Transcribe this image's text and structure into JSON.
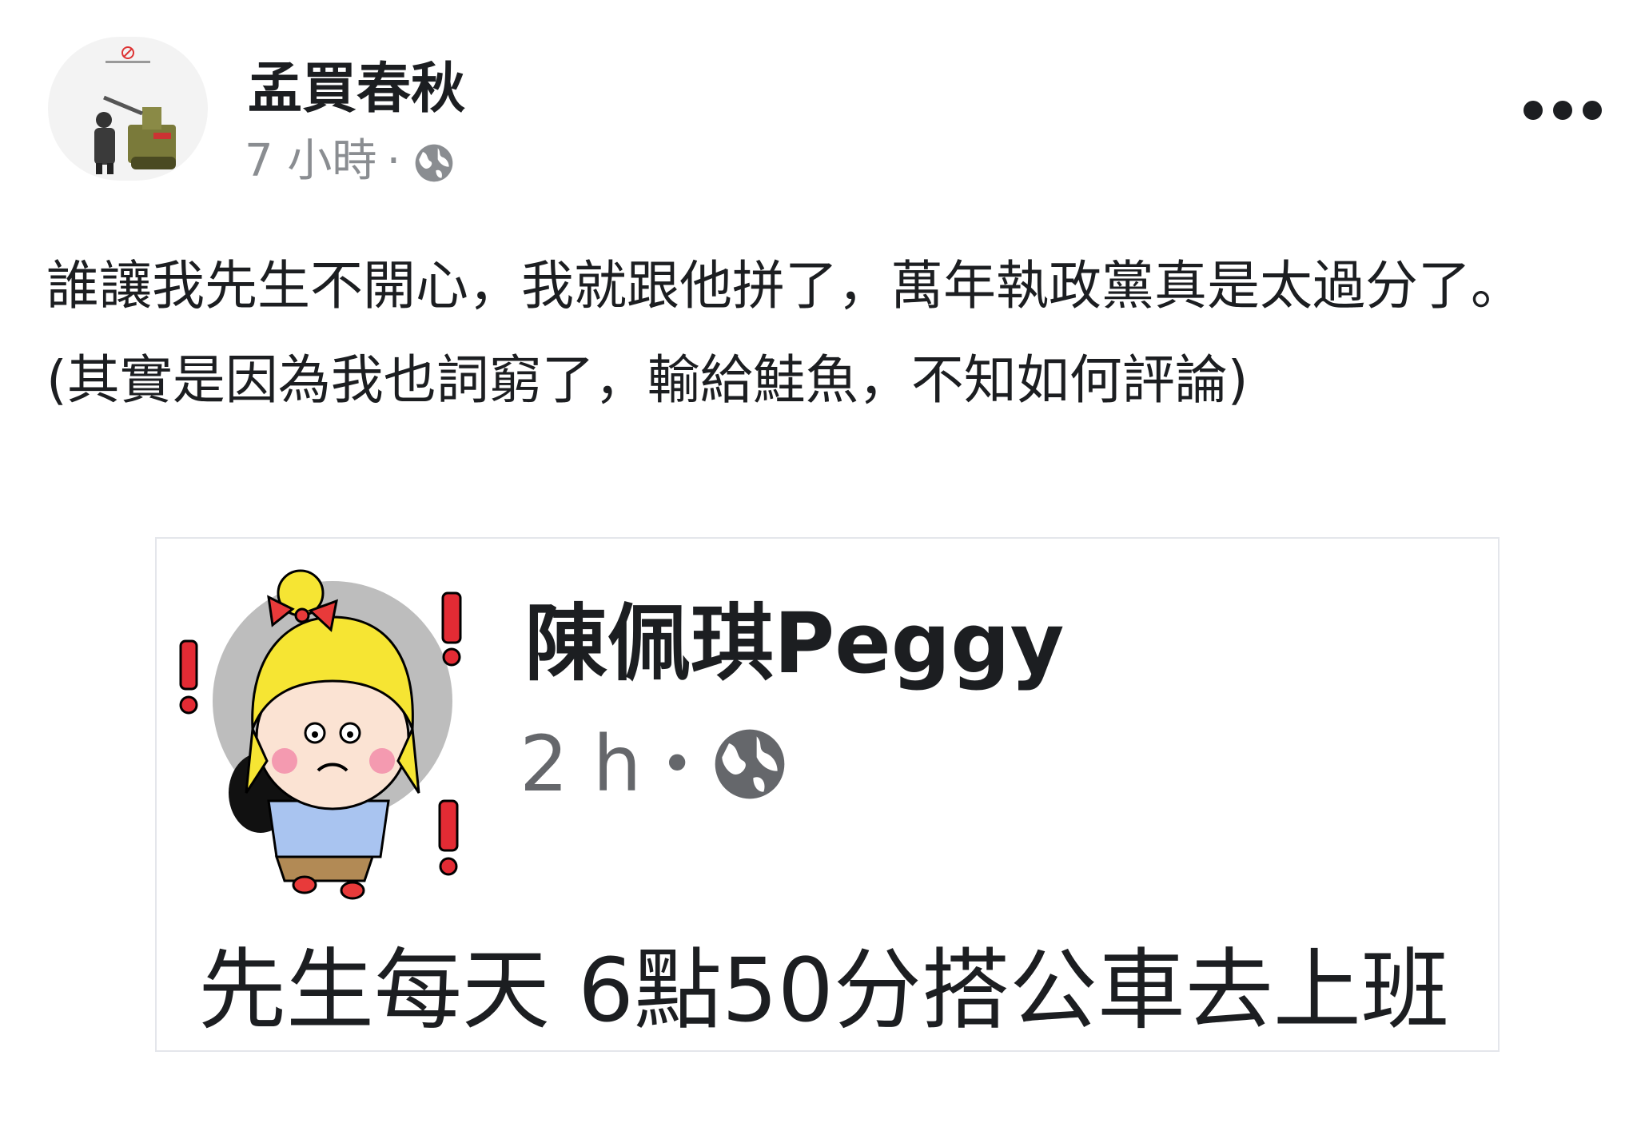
{
  "post": {
    "author": "孟買春秋",
    "timestamp": "7 小時",
    "separator": "·",
    "privacy_icon": "globe-icon",
    "more_icon": "more-options-icon",
    "paragraphs": [
      "誰讓我先生不開心，我就跟他拼了，萬年執政黨真是太過分了。",
      "(其實是因為我也詞窮了，輸給鮭魚，不知如何評論)"
    ]
  },
  "shared_post": {
    "author": "陳佩琪Peggy",
    "timestamp": "2 h",
    "separator": "•",
    "privacy_icon": "globe-icon",
    "text": "先生每天 6點50分搭公車去上班"
  },
  "colors": {
    "text": "#1c1e21",
    "meta": "#8a8d91",
    "card_border": "#e4e6eb",
    "exclaim_red": "#e32b34",
    "hair_yellow": "#f6e533"
  }
}
